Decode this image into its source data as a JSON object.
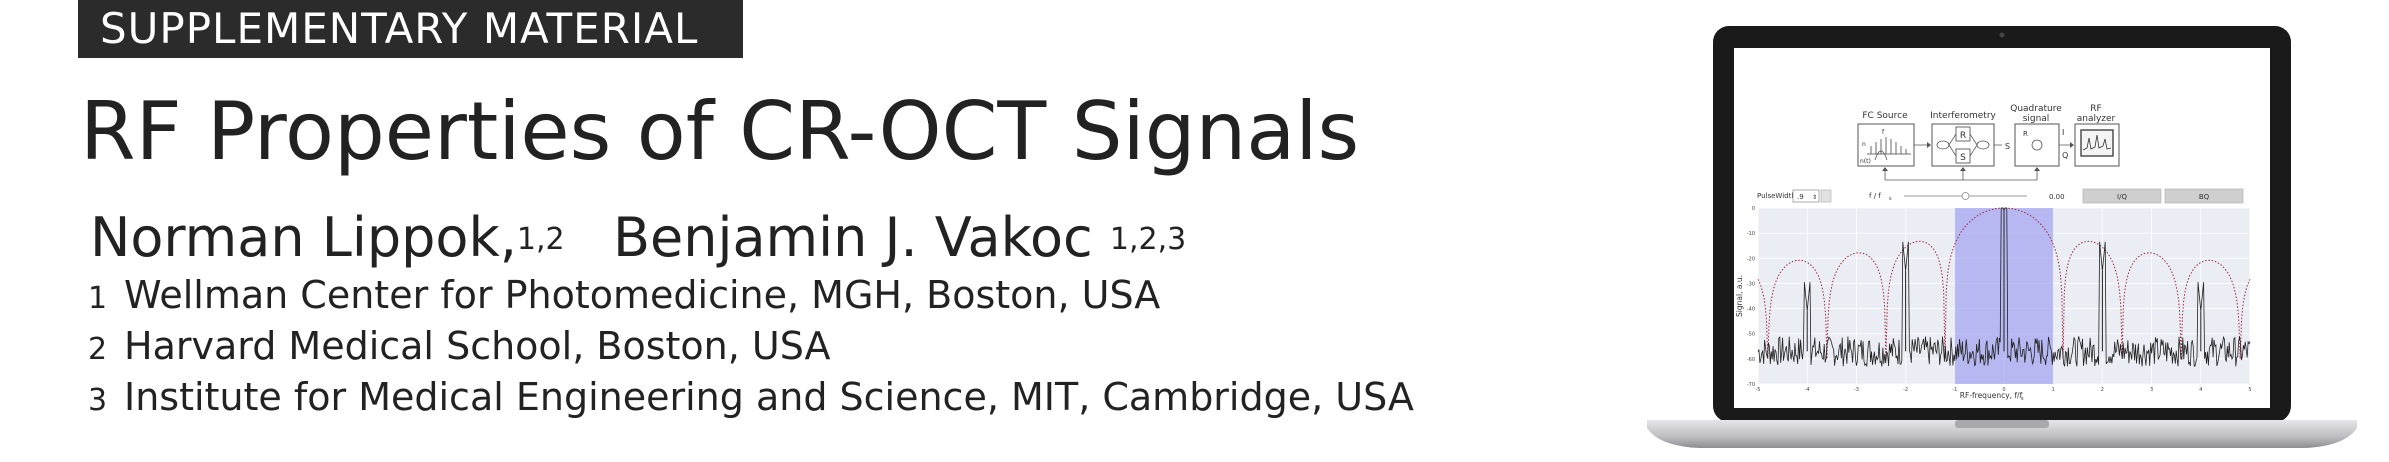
{
  "header": {
    "tag": "SUPPLEMENTARY MATERIAL"
  },
  "title": "RF Properties of CR-OCT Signals",
  "authors": [
    {
      "name": "Norman Lippok,",
      "sup": "1,2"
    },
    {
      "name": "Benjamin J. Vakoc",
      "sup": "1,2,3"
    }
  ],
  "affiliations": [
    {
      "num": "1",
      "text": "Wellman Center for Photomedicine, MGH, Boston, USA"
    },
    {
      "num": "2",
      "text": "Harvard Medical School, Boston, USA"
    },
    {
      "num": "3",
      "text": "Institute for Medical Engineering and Science, MIT, Cambridge, USA"
    }
  ],
  "screen": {
    "diagram": {
      "fc_source": "FC Source",
      "fc_f": "f",
      "fc_f_sub": "FSR",
      "fc_n": "n",
      "fc_nt": "n(t)",
      "interferometry": "Interferometry",
      "R": "R",
      "S": "S",
      "quadrature_1": "Quadrature",
      "quadrature_2": "signal",
      "quad_R": "R",
      "quad_S": "S",
      "quad_I": "I",
      "quad_Q": "Q",
      "rf_1": "RF",
      "rf_2": "analyzer"
    },
    "controls": {
      "pulse_width_label": "PulseWidth",
      "pulse_width_value": ".9",
      "ff_label": "f / f",
      "ff_sub": "s",
      "ff_value": "0.00",
      "ff_slider_fraction": 0.5,
      "btn_iq": "I/Q",
      "btn_bq": "BQ"
    },
    "chart_data": {
      "type": "line",
      "ylabel": "Signal, a.u.",
      "xlabel": "RF-frequency, f/f",
      "xlabel_sub": "s",
      "xlim": [
        -5,
        5
      ],
      "ylim": [
        -70,
        0
      ],
      "x_ticks": [
        "-5",
        "-4",
        "-3",
        "-2",
        "-1",
        "0",
        "1",
        "2",
        "3",
        "4",
        "5"
      ],
      "y_ticks": [
        "-70",
        "-60",
        "-50",
        "-40",
        "-30",
        "-20",
        "-10",
        "0"
      ],
      "highlight_band": [
        -1,
        1
      ],
      "peaks": [
        {
          "x": -4,
          "y": -41
        },
        {
          "x": -2,
          "y": -25
        },
        {
          "x": 0,
          "y": -1
        },
        {
          "x": 2,
          "y": -25
        },
        {
          "x": 4,
          "y": -41
        }
      ],
      "noise_floor": -57,
      "envelope_note": "dotted sinc-squared envelope with nulls near x = ±1.2, ±3.6"
    }
  },
  "colors": {
    "tag_bg": "#2b2b2b",
    "band": "#8c8cf0",
    "envelope": "#a0283c",
    "signal": "#222222",
    "plot_bg": "#eaedf4"
  }
}
